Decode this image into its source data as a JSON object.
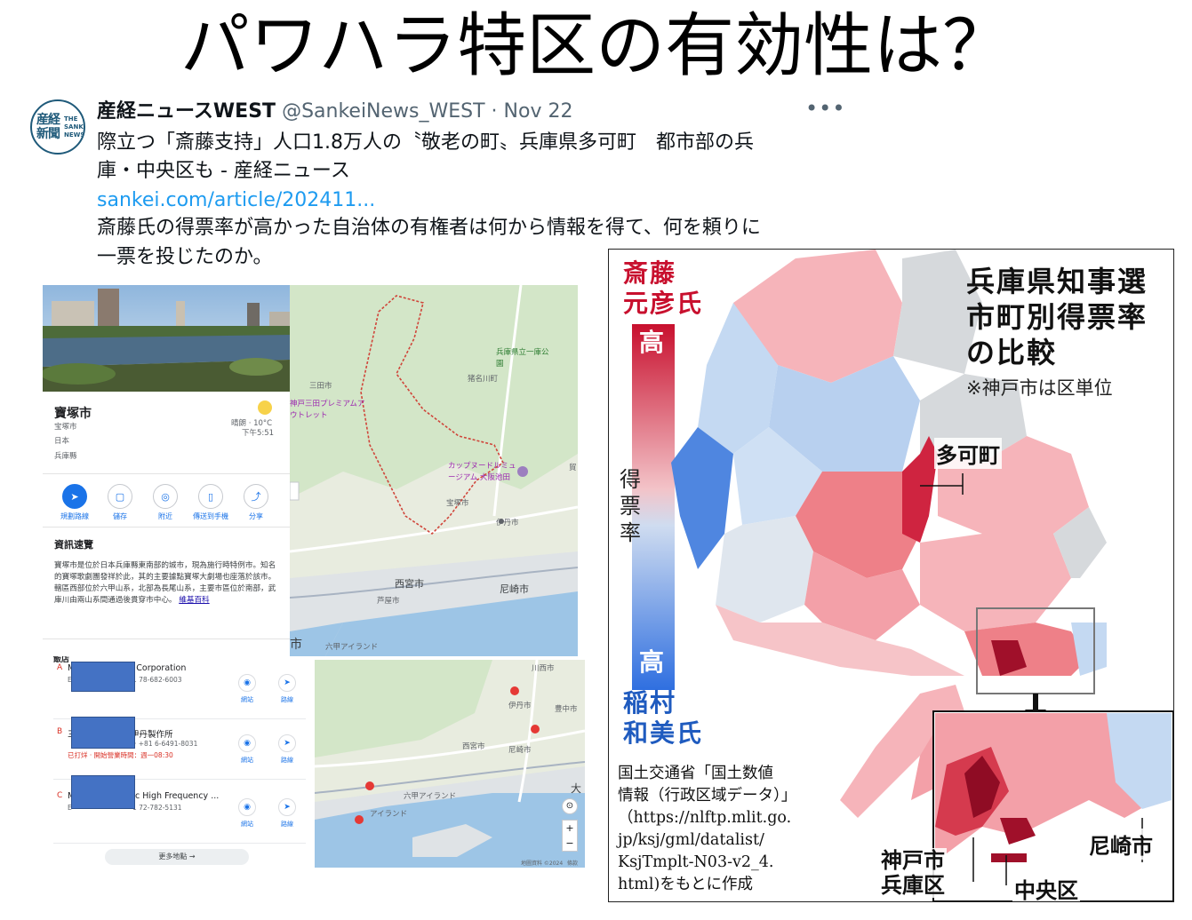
{
  "slide": {
    "title": "パワハラ特区の有効性は？"
  },
  "tweet": {
    "avatar_kanji": "産経新聞",
    "avatar_text": "THE SANKEI NEWS",
    "name": "産経ニュースWEST",
    "handle": "@SankeiNews_WEST · Nov 22",
    "more": "•••",
    "line1": "際立つ「斎藤支持」人口1.8万人の〝敬老の町〟兵庫県多可町　都市部の兵",
    "line2": "庫・中央区も - 産経ニュース",
    "link": "sankei.com/article/202411...",
    "line3": "斎藤氏の得票率が高かった自治体の有権者は何から情報を得て、何を頼りに",
    "line4": "一票を投じたのか。"
  },
  "maps_panel": {
    "place_name": "寶塚市",
    "place_sub1": "宝塚市",
    "place_sub2": "日本",
    "place_sub3": "兵庫縣",
    "weather": "晴朗 · 10°C",
    "time": "下午5:51",
    "actions": [
      "規劃路線",
      "儲存",
      "附近",
      "傳送到手機",
      "分享"
    ],
    "section_title": "資訊速覽",
    "description": "寶塚市是位於日本兵庫縣東南部的城市，現為施行時特例市。知名的寶塚歌劇團發祥於此，其的主要據點寶塚大劇場也座落於該市。轄區西部位於六甲山系，北部為長尾山系，主要市區位於南部，武庫川由兩山系間通過後貫穿市中心。",
    "wiki": "維基百科",
    "map_labels": [
      "兵庫県立一庫公園",
      "猪名川町",
      "三田市",
      "神戸三田プレミアムアウトレット",
      "カップヌードルミュージアム 大阪池田",
      "宝塚市",
      "伊丹市",
      "西宮市",
      "尼崎市",
      "芦屋市",
      "六甲アイランド",
      "市",
      "貿"
    ]
  },
  "results": {
    "heading": "飯店",
    "rows": [
      {
        "letter": "A",
        "name": "c Corporation",
        "phone": "1 78-682-6003",
        "lead": "M",
        "sub_lead": "E"
      },
      {
        "letter": "B",
        "name": "伊丹製作所",
        "phone": "· +81 6-6491-8031",
        "lead": "三",
        "warn": "已打烊 · 開始營業時間：週一08:30"
      },
      {
        "letter": "C",
        "name": "c High Frequency ...",
        "phone": "1 72-782-5131",
        "lead": "M",
        "sub_lead": "E"
      }
    ],
    "btn_web": "網站",
    "btn_route": "路線",
    "more_places": "更多地點 →"
  },
  "map2": {
    "labels": [
      "川西市",
      "伊丹市",
      "豊中市",
      "西宮市",
      "尼崎市",
      "六甲アイランド",
      "アイランド"
    ],
    "copyright": "地圖資料 ©2024",
    "terms": "條款",
    "big_label": "大"
  },
  "figure": {
    "cand_red": "斎藤\n元彦氏",
    "high_top": "高",
    "axis_label": "得\n票\n率",
    "high_bottom": "高",
    "cand_blue": "稲村\n和美氏",
    "title": "兵庫県知事選\n市町別得票率\nの比較",
    "note": "※神戸市は区単位",
    "callout_taka": "多可町",
    "callout_kobe": "神戸市\n兵庫区",
    "callout_chuo": "中央区",
    "callout_ama": "尼崎市",
    "source": "国土交通省「国土数値\n情報（行政区域データ）」\n（https://nlftp.mlit.go.\njp/ksj/gml/datalist/\nKsjTmplt-N03-v2_4.\nhtml)をもとに作成",
    "colors": {
      "red_strong": "#c8102e",
      "red_light": "#f4a7ae",
      "grey": "#d6d9dc",
      "blue_light": "#c4d9f2",
      "blue_strong": "#3a78e0"
    }
  }
}
